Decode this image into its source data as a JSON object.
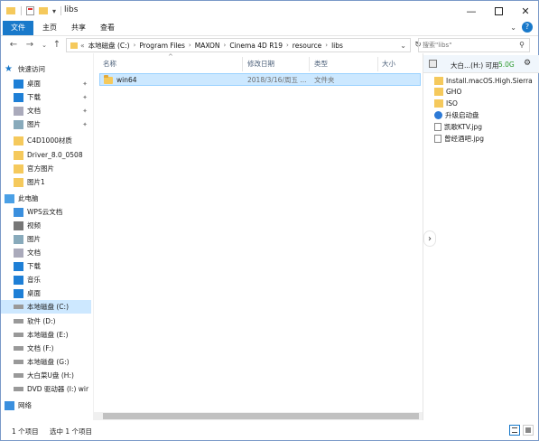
{
  "window": {
    "title": "libs"
  },
  "ribbon": {
    "tabs": [
      "文件",
      "主页",
      "共享",
      "查看"
    ]
  },
  "address": {
    "prefix": "«",
    "crumbs": [
      "本地磁盘 (C:)",
      "Program Files",
      "MAXON",
      "Cinema 4D R19",
      "resource",
      "libs"
    ],
    "search_placeholder": "搜索\"libs\""
  },
  "nav": {
    "quick_access": "快速访问",
    "items": [
      {
        "label": "桌面",
        "icon": "desktop-icon",
        "pinned": true
      },
      {
        "label": "下载",
        "icon": "download-icon",
        "pinned": true
      },
      {
        "label": "文档",
        "icon": "documents-icon",
        "pinned": true
      },
      {
        "label": "图片",
        "icon": "pictures-icon",
        "pinned": true
      },
      {
        "label": "C4D1000材质",
        "icon": "folder-icon"
      },
      {
        "label": "Driver_8.0_0508",
        "icon": "folder-icon"
      },
      {
        "label": "官方图片",
        "icon": "folder-icon"
      },
      {
        "label": "图片1",
        "icon": "folder-icon"
      },
      {
        "label": "此电脑",
        "icon": "this-pc-icon"
      },
      {
        "label": "WPS云文档",
        "icon": "cloud-icon"
      },
      {
        "label": "视频",
        "icon": "video-icon"
      },
      {
        "label": "图片",
        "icon": "pictures-icon"
      },
      {
        "label": "文档",
        "icon": "documents-icon"
      },
      {
        "label": "下载",
        "icon": "download-icon"
      },
      {
        "label": "音乐",
        "icon": "music-icon"
      },
      {
        "label": "桌面",
        "icon": "desktop-icon"
      },
      {
        "label": "本地磁盘 (C:)",
        "icon": "drive-icon",
        "selected": true
      },
      {
        "label": "软件 (D:)",
        "icon": "drive-icon"
      },
      {
        "label": "本地磁盘 (E:)",
        "icon": "drive-icon"
      },
      {
        "label": "文档 (F:)",
        "icon": "drive-icon"
      },
      {
        "label": "本地磁盘 (G:)",
        "icon": "drive-icon"
      },
      {
        "label": "大白菜U盘 (H:)",
        "icon": "usb-icon"
      },
      {
        "label": "DVD 驱动器 (I:) wir",
        "icon": "dvd-icon"
      },
      {
        "label": "网络",
        "icon": "network-icon"
      }
    ]
  },
  "columns": {
    "name": "名称",
    "date": "修改日期",
    "type": "类型",
    "size": "大小"
  },
  "files": [
    {
      "name": "win64",
      "date": "2018/3/16/周五 ...",
      "type": "文件夹",
      "size": ""
    }
  ],
  "preview": {
    "title": "大白...(H:) 可用",
    "free": "5.0G",
    "items": [
      {
        "label": "Install.macOS.High.Sierra",
        "icon": "folder-icon"
      },
      {
        "label": "GHO",
        "icon": "folder-icon"
      },
      {
        "label": "ISO",
        "icon": "folder-icon"
      },
      {
        "label": "升级启动盘",
        "icon": "app-icon"
      },
      {
        "label": "凯歌KTV.jpg",
        "icon": "image-file-icon"
      },
      {
        "label": "曾经酒吧.jpg",
        "icon": "image-file-icon"
      }
    ]
  },
  "status": {
    "count": "1 个项目",
    "selected": "选中 1 个项目"
  },
  "colors": {
    "accent": "#1979ca",
    "selection": "#cce8ff",
    "folder": "#f5c95c",
    "free_space": "#2e9a2e"
  }
}
